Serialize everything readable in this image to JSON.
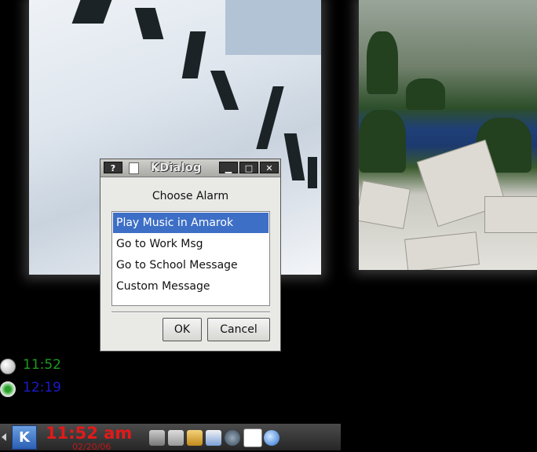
{
  "dialog": {
    "title": "KDialog",
    "help_btn": "?",
    "prompt": "Choose Alarm",
    "items": [
      "Play Music in Amarok",
      "Go to Work Msg",
      "Go to School Message",
      "Custom Message"
    ],
    "selected_index": 0,
    "ok_label": "OK",
    "cancel_label": "Cancel",
    "selection_color": "#3d6fc6"
  },
  "alarms": [
    {
      "time": "11:52",
      "color": "#1e9a1e",
      "icon": "alarm-off-icon"
    },
    {
      "time": "12:19",
      "color": "#1a1acc",
      "icon": "alarm-on-icon"
    }
  ],
  "taskbar": {
    "time": "11:52 am",
    "date": "02/20/06",
    "clock_color": "#e21a1a",
    "tray_icons": [
      "printer-icon",
      "scanner-icon",
      "kde-k-icon",
      "user-card-icon",
      "network-globe-icon",
      "klipper-icon",
      "kde-sphere-icon"
    ]
  }
}
